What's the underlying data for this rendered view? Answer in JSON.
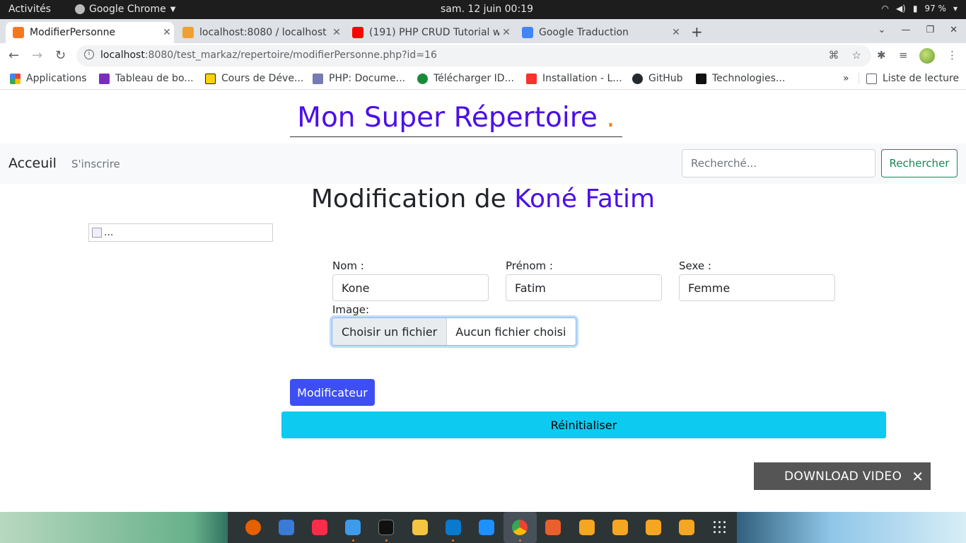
{
  "system": {
    "activities": "Activités",
    "app_name": "Google Chrome",
    "clock": "sam. 12 juin  00:19",
    "battery": "97 %"
  },
  "tabs": [
    {
      "title": "ModifierPersonne",
      "active": true,
      "favicon_color": "#f5781f"
    },
    {
      "title": "localhost:8080 / localhost",
      "active": false,
      "favicon_color": "#f0a030"
    },
    {
      "title": "(191) PHP CRUD Tutorial w",
      "active": false,
      "favicon_color": "#ff0000"
    },
    {
      "title": "Google Traduction",
      "active": false,
      "favicon_color": "#4285f4"
    }
  ],
  "omnibox": {
    "host": "localhost",
    "path": ":8080/test_markaz/repertoire/modifierPersonne.php?id=16"
  },
  "bookmarks": {
    "items": [
      {
        "label": "Applications",
        "icon": "apps-grid-icon"
      },
      {
        "label": "Tableau de bo...",
        "icon": "dashboard-icon"
      },
      {
        "label": "Cours de Déve...",
        "icon": "course-icon"
      },
      {
        "label": "PHP: Docume...",
        "icon": "php-icon"
      },
      {
        "label": "Télécharger ID...",
        "icon": "download-icon"
      },
      {
        "label": "Installation - L...",
        "icon": "laravel-icon"
      },
      {
        "label": "GitHub",
        "icon": "github-icon"
      },
      {
        "label": "Technologies...",
        "icon": "tech-icon"
      }
    ],
    "more": "»",
    "reading_list": "Liste de lecture"
  },
  "site": {
    "title": "Mon Super Répertoire",
    "title_accent": "."
  },
  "navbar": {
    "brand": "Acceuil",
    "link": "S'inscrire",
    "search_placeholder": "Recherché...",
    "search_button": "Rechercher"
  },
  "heading": {
    "prefix": "Modification de",
    "name": "Koné Fatim"
  },
  "image_alt": "...",
  "form": {
    "nom_label": "Nom :",
    "nom_value": "Kone",
    "prenom_label": "Prénom :",
    "prenom_value": "Fatim",
    "sexe_label": "Sexe :",
    "sexe_value": "Femme",
    "image_label": "Image:",
    "file_button": "Choisir un fichier",
    "file_status": "Aucun fichier choisi",
    "submit": "Modificateur",
    "reset": "Réinitialiser"
  },
  "overlay": {
    "download_label": "DOWNLOAD VIDEO",
    "close": "✕"
  },
  "dock": [
    {
      "name": "firefox-icon",
      "color": "#e66000"
    },
    {
      "name": "mail-icon",
      "color": "#3a7bd5"
    },
    {
      "name": "music-icon",
      "color": "#fa2d48"
    },
    {
      "name": "finder-icon",
      "color": "#3d9be9"
    },
    {
      "name": "terminal-icon",
      "color": "#111111"
    },
    {
      "name": "text-editor-icon",
      "color": "#f4c542"
    },
    {
      "name": "vscode-icon",
      "color": "#0a7acc"
    },
    {
      "name": "app-store-icon",
      "color": "#1e90ff"
    },
    {
      "name": "chrome-icon",
      "color": "#dddddd"
    },
    {
      "name": "screenshot-icon",
      "color": "#e8602c"
    },
    {
      "name": "folder-icon-1",
      "color": "#f5a623"
    },
    {
      "name": "folder-icon-2",
      "color": "#f5a623"
    },
    {
      "name": "folder-icon-3",
      "color": "#f5a623"
    },
    {
      "name": "folder-icon-4",
      "color": "#f5a623"
    },
    {
      "name": "show-apps-icon",
      "color": "#dddddd"
    }
  ]
}
